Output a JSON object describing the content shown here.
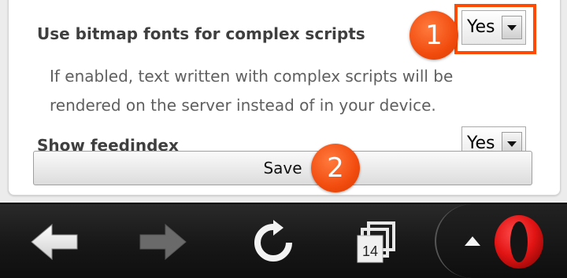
{
  "settings": {
    "bitmap_fonts": {
      "label": "Use bitmap fonts for complex scripts",
      "value": "Yes",
      "description_line1": "If enabled, text written with complex scripts will be",
      "description_line2": "rendered on the server instead of in your device."
    },
    "feedindex": {
      "label": "Show feedindex",
      "value": "Yes"
    },
    "save_label": "Save"
  },
  "annotations": {
    "step1": "1",
    "step2": "2",
    "highlight_color": "#ff4a00"
  },
  "toolbar": {
    "tabs_count": "14",
    "icons": [
      "back-arrow-icon",
      "forward-arrow-icon",
      "reload-icon",
      "tabs-icon",
      "menu-up-icon",
      "opera-logo-icon"
    ]
  }
}
